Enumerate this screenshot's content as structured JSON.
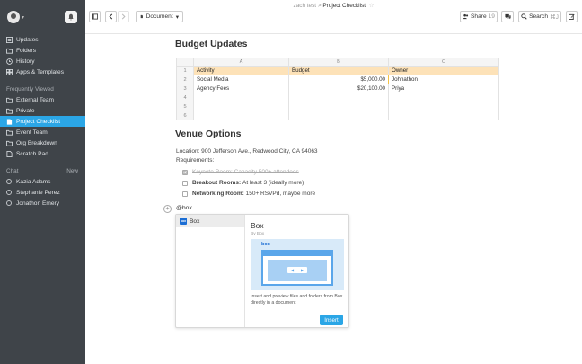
{
  "breadcrumb": {
    "parent": "zach test",
    "separator": ">",
    "current": "Project Checklist"
  },
  "sidebar": {
    "nav": [
      {
        "label": "Updates",
        "icon": "updates-icon"
      },
      {
        "label": "Folders",
        "icon": "folder-icon"
      },
      {
        "label": "History",
        "icon": "history-icon"
      },
      {
        "label": "Apps & Templates",
        "icon": "apps-icon"
      }
    ],
    "frequent_title": "Frequently Viewed",
    "frequent": [
      {
        "label": "External Team",
        "icon": "folder-icon"
      },
      {
        "label": "Private",
        "icon": "folder-icon"
      },
      {
        "label": "Project Checklist",
        "icon": "document-icon",
        "active": true
      },
      {
        "label": "Event Team",
        "icon": "folder-icon"
      },
      {
        "label": "Org Breakdown",
        "icon": "folder-icon"
      },
      {
        "label": "Scratch Pad",
        "icon": "document-icon"
      }
    ],
    "chat_title": "Chat",
    "chat_new": "New",
    "chat": [
      {
        "label": "Kazia Adams"
      },
      {
        "label": "Stephanie Perez"
      },
      {
        "label": "Jonathon Emery"
      }
    ]
  },
  "toolbar": {
    "doc_label": "Document",
    "share_label": "Share",
    "share_count": "19",
    "search_label": "Search",
    "search_shortcut": "⌘J"
  },
  "doc": {
    "h_budget": "Budget Updates",
    "sheet": {
      "columns": [
        "A",
        "B",
        "C"
      ],
      "row_numbers": [
        "1",
        "2",
        "3",
        "4",
        "5",
        "6"
      ],
      "rows": [
        [
          "Activity",
          "Budget",
          "Owner"
        ],
        [
          "Social Media",
          "$5,000.00",
          "Johnathon"
        ],
        [
          "Agency Fees",
          "$20,100.00",
          "Priya"
        ],
        [
          "",
          "",
          ""
        ],
        [
          "",
          "",
          ""
        ],
        [
          "",
          "",
          ""
        ]
      ]
    },
    "h_venue": "Venue Options",
    "location": "Location: 900 Jefferson Ave., Redwood City, CA 94063",
    "requirements": "Requirements:",
    "checklist": [
      {
        "title": "Keynote Room:",
        "detail": "Capacity 500+ attendees",
        "done": true
      },
      {
        "title": "Breakout Rooms:",
        "detail": "At least 3 (ideally more)",
        "done": false
      },
      {
        "title": "Networking Room:",
        "detail": "150+ RSVPd, maybe more",
        "done": false
      }
    ],
    "at_text": "@box"
  },
  "popup": {
    "option_label": "Box",
    "logo_text": "box",
    "title": "Box",
    "by": "By Box",
    "preview_logo": "box",
    "description": "Insert and preview files and folders from Box directly in a document",
    "insert_label": "Insert"
  },
  "colors": {
    "sidebar_bg": "#3f4449",
    "accent": "#2ba6e6",
    "header_row": "#fde2b8",
    "box_blue": "#1c6ed4"
  }
}
